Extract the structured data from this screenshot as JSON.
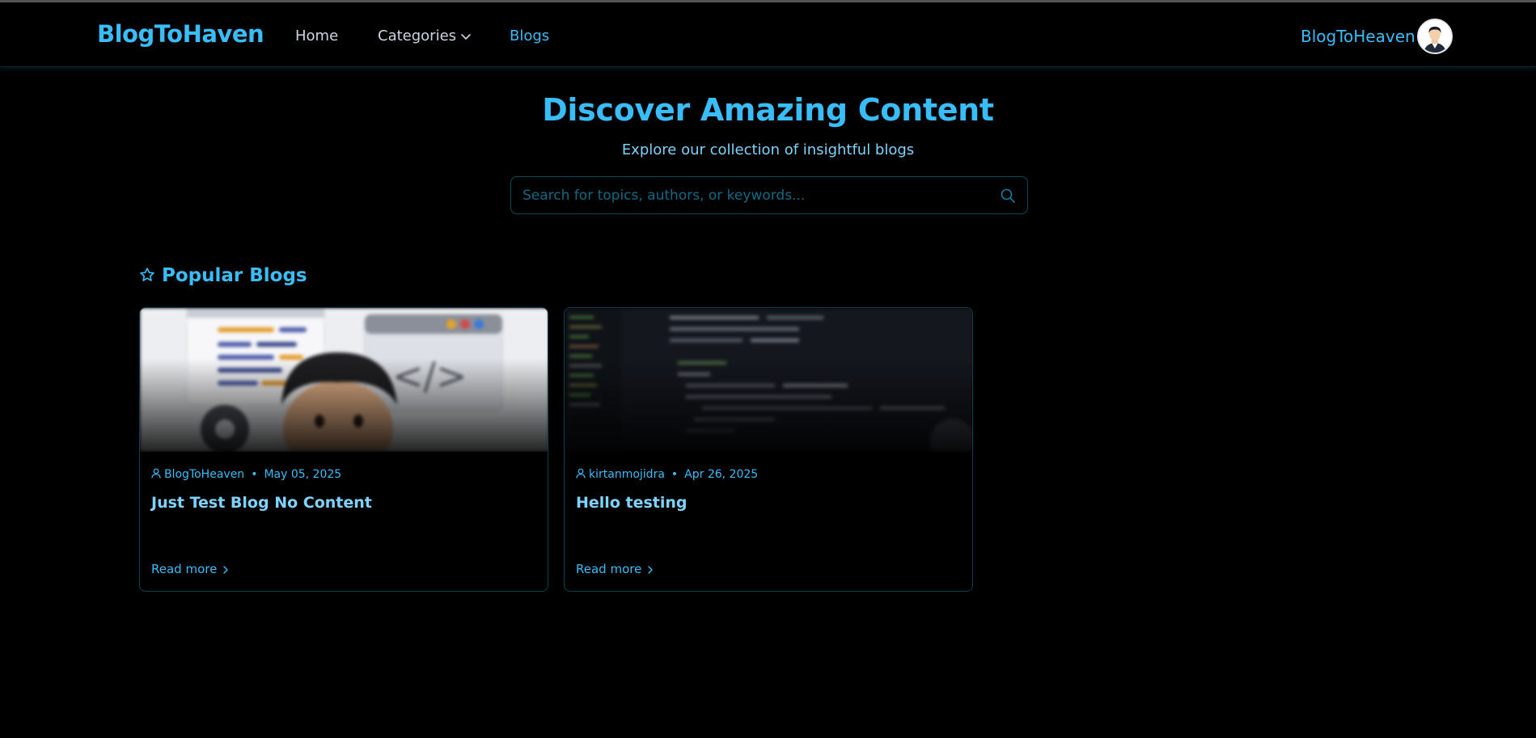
{
  "header": {
    "logo": "BlogToHaven",
    "nav": [
      {
        "label": "Home"
      },
      {
        "label": "Categories"
      },
      {
        "label": "Blogs"
      }
    ],
    "user_name": "BlogToHeaven"
  },
  "hero": {
    "title": "Discover Amazing Content",
    "subtitle": "Explore our collection of insightful blogs",
    "search_placeholder": "Search for topics, authors, or keywords..."
  },
  "popular": {
    "title": "Popular Blogs",
    "cards": [
      {
        "author": "BlogToHeaven",
        "separator": "•",
        "date": "May 05, 2025",
        "title": "Just Test Blog No Content",
        "link": "Read more"
      },
      {
        "author": "kirtanmojidra",
        "separator": "•",
        "date": "Apr 26, 2025",
        "title": "Hello testing",
        "link": "Read more"
      }
    ]
  },
  "icons": {
    "search": "search-icon",
    "star": "star-icon",
    "user": "user-icon",
    "chevron_down": "chevron-down-icon",
    "chevron_right": "chevron-right-icon"
  },
  "colors": {
    "accent": "#38bdf8",
    "background": "#000000"
  }
}
